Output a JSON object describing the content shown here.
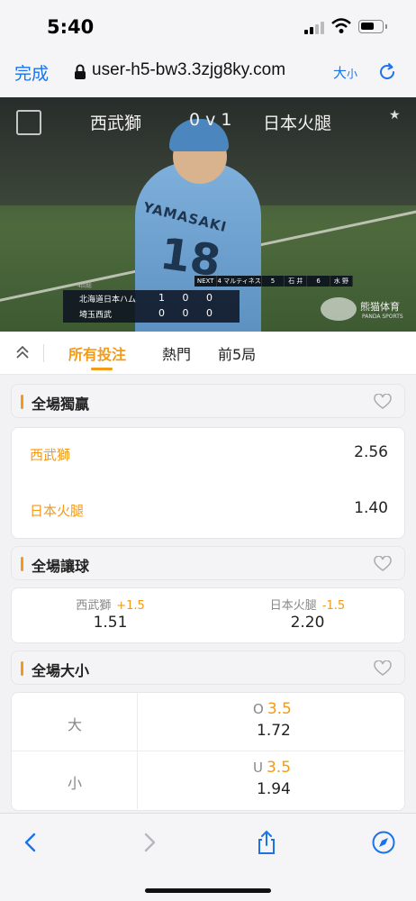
{
  "status": {
    "time": "5:40"
  },
  "browser": {
    "done_label": "完成",
    "url": "user-h5-bw3.3zjg8ky.com",
    "text_size_big": "大",
    "text_size_small": "小"
  },
  "video": {
    "team_a": "西武獅",
    "score": "0 v 1",
    "team_b": "日本火腿",
    "jersey_name": "YAMASAKI",
    "jersey_number": "18",
    "scoreboard": {
      "header": "4回総",
      "next_bar": [
        "NEXT",
        "4 マルティネス",
        "5",
        "石 井",
        "6",
        "水 野"
      ],
      "rows": [
        {
          "team": "北海道日本ハム",
          "runs": "1 0 0"
        },
        {
          "team": "埼玉西武",
          "runs": "0 0 0"
        }
      ]
    },
    "broadcaster": {
      "name": "熊猫体育",
      "sub": "PANDA SPORTS"
    }
  },
  "tabs": [
    {
      "label": "所有投注",
      "active": true
    },
    {
      "label": "熱門",
      "active": false
    },
    {
      "label": "前5局",
      "active": false
    }
  ],
  "moneyline": {
    "title": "全場獨贏",
    "rows": [
      {
        "team": "西武獅",
        "odds": "2.56"
      },
      {
        "team": "日本火腿",
        "odds": "1.40"
      }
    ]
  },
  "handicap": {
    "title": "全場讓球",
    "cols": [
      {
        "team": "西武獅",
        "line": "+1.5",
        "odds": "1.51"
      },
      {
        "team": "日本火腿",
        "line": "-1.5",
        "odds": "2.20"
      }
    ]
  },
  "totals": {
    "title": "全場大小",
    "rows": [
      {
        "side": "大",
        "prefix": "O",
        "line": "3.5",
        "odds": "1.72"
      },
      {
        "side": "小",
        "prefix": "U",
        "line": "3.5",
        "odds": "1.94"
      }
    ]
  },
  "colors": {
    "accent": "#f39a16",
    "link": "#1a73e8"
  },
  "icons": [
    "back-icon",
    "forward-icon",
    "share-icon",
    "compass-icon",
    "reload-icon",
    "lock-icon",
    "heart-icon",
    "collapse-icon"
  ]
}
